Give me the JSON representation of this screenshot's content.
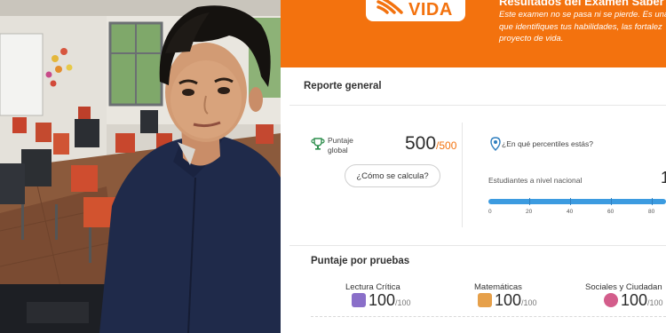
{
  "header": {
    "logo_text": "VIDA",
    "title_partial": "Resultados del Examen Saber",
    "intro_text_lines": [
      "Este examen no se pasa ni se pierde. Es una",
      "que identifiques tus habilidades, las fortalez",
      "proyecto de vida."
    ]
  },
  "general_report": {
    "title": "Reporte general",
    "score_label": "Puntaje global",
    "score_value": "500",
    "score_max": "/500",
    "how_calculated_button": "¿Cómo se calcula?",
    "percentile_question": "¿En qué percentiles estás?",
    "percentile_scope_label": "Estudiantes a nivel nacional",
    "percentile_value_partial": "1",
    "percentile_scale": [
      "0",
      "20",
      "40",
      "60",
      "80"
    ],
    "percentile_fill_fraction": 1.0
  },
  "scores_by_test": {
    "title": "Puntaje por pruebas",
    "subjects": [
      {
        "name": "Lectura Crítica",
        "value": "100",
        "max": "/100",
        "icon": "book-icon",
        "color": "#8a6fc9"
      },
      {
        "name": "Matemáticas",
        "value": "100",
        "max": "/100",
        "icon": "calculator-icon",
        "color": "#e6a04a"
      },
      {
        "name": "Sociales y Ciudadan",
        "value": "100",
        "max": "/100",
        "icon": "globe-icon",
        "color": "#d35d8b"
      }
    ]
  },
  "colors": {
    "brand_orange": "#f3720e",
    "percentile_blue": "#3c9be0"
  }
}
